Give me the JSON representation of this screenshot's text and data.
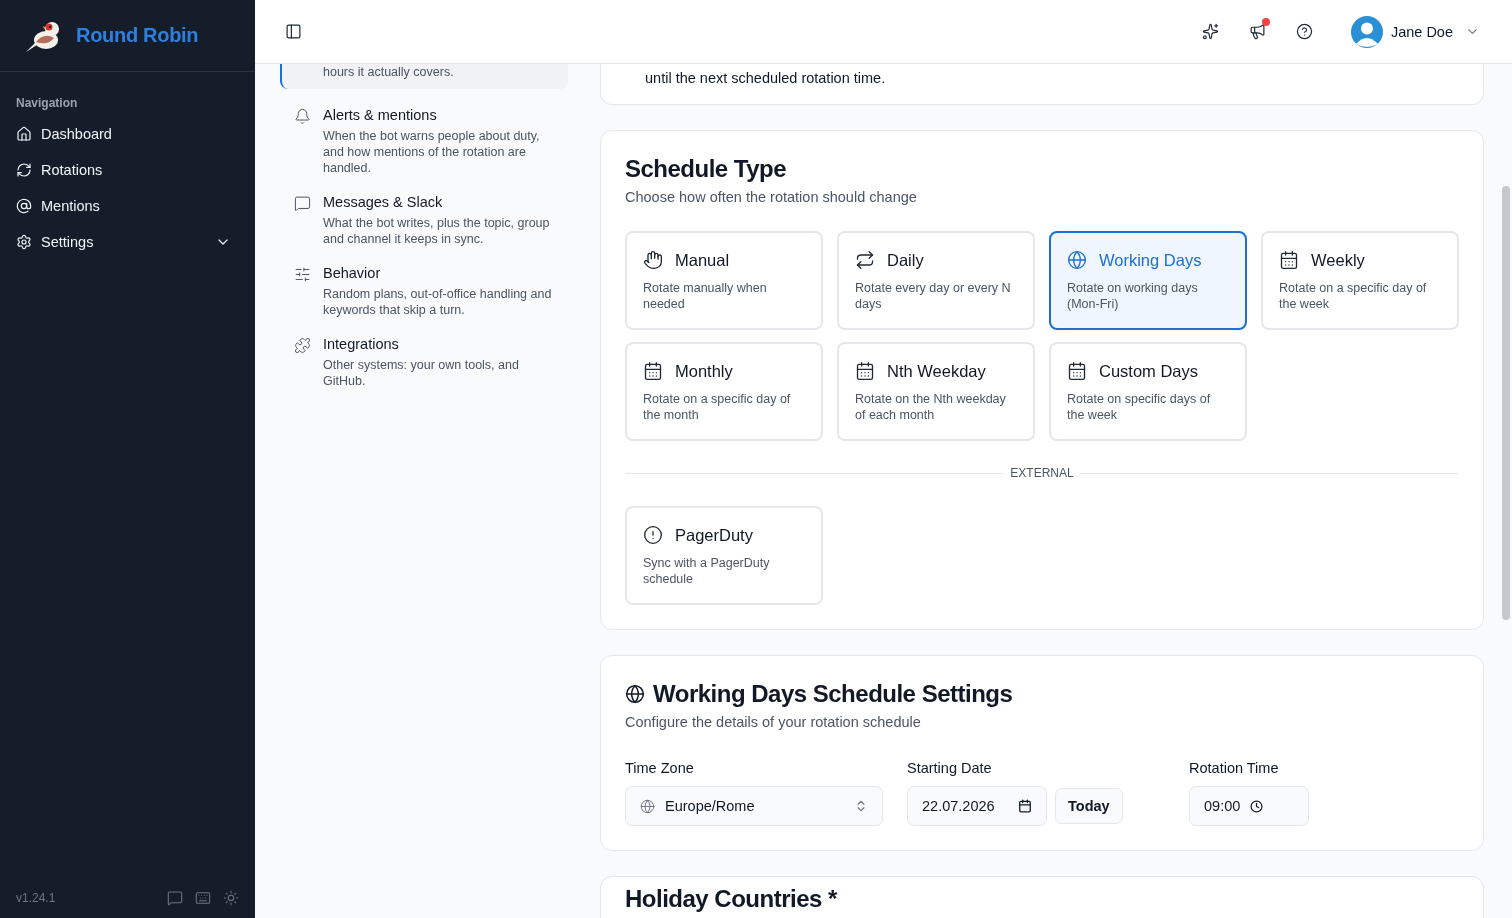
{
  "app": {
    "name": "Round Robin",
    "version": "v1.24.1"
  },
  "sidebar": {
    "section": "Navigation",
    "items": [
      {
        "label": "Dashboard",
        "selected": false
      },
      {
        "label": "Rotations",
        "selected": false
      },
      {
        "label": "Mentions",
        "selected": false
      },
      {
        "label": "Settings",
        "selected": false,
        "expanded": false
      }
    ]
  },
  "header": {
    "user": "Jane Doe",
    "has_notification": true
  },
  "settings_nav": [
    {
      "description": "hours it actually covers.",
      "selected": true
    },
    {
      "title": "Alerts & mentions",
      "description": "When the bot warns people about duty, and how mentions of the rotation are handled.",
      "selected": false
    },
    {
      "title": "Messages & Slack",
      "description": "What the bot writes, plus the topic, group and channel it keeps in sync.",
      "selected": false
    },
    {
      "title": "Behavior",
      "description": "Random plans, out-of-office handling and keywords that skip a turn.",
      "selected": false
    },
    {
      "title": "Integrations",
      "description": "Other systems: your own tools, and GitHub.",
      "selected": false
    }
  ],
  "previous_card": {
    "text": "until the next scheduled rotation time."
  },
  "schedule_type": {
    "title": "Schedule Type",
    "subtitle": "Choose how often the rotation should change",
    "options": [
      {
        "label": "Manual",
        "description": "Rotate manually when needed",
        "selected": false
      },
      {
        "label": "Daily",
        "description": "Rotate every day or every N days",
        "selected": false
      },
      {
        "label": "Working Days",
        "description": "Rotate on working days (Mon-Fri)",
        "selected": true
      },
      {
        "label": "Weekly",
        "description": "Rotate on a specific day of the week",
        "selected": false
      },
      {
        "label": "Monthly",
        "description": "Rotate on a specific day of the month",
        "selected": false
      },
      {
        "label": "Nth Weekday",
        "description": "Rotate on the Nth weekday of each month",
        "selected": false
      },
      {
        "label": "Custom Days",
        "description": "Rotate on specific days of the week",
        "selected": false
      }
    ],
    "external_label": "EXTERNAL",
    "external_options": [
      {
        "label": "PagerDuty",
        "description": "Sync with a PagerDuty schedule",
        "selected": false
      }
    ]
  },
  "schedule_settings": {
    "title": "Working Days Schedule Settings",
    "subtitle": "Configure the details of your rotation schedule",
    "time_zone": {
      "label": "Time Zone",
      "value": "Europe/Rome"
    },
    "starting_date": {
      "label": "Starting Date",
      "value": "22.07.2026",
      "button": "Today"
    },
    "rotation_time": {
      "label": "Rotation Time",
      "value": "09:00"
    }
  },
  "holiday_card": {
    "title": "Holiday Countries *"
  }
}
